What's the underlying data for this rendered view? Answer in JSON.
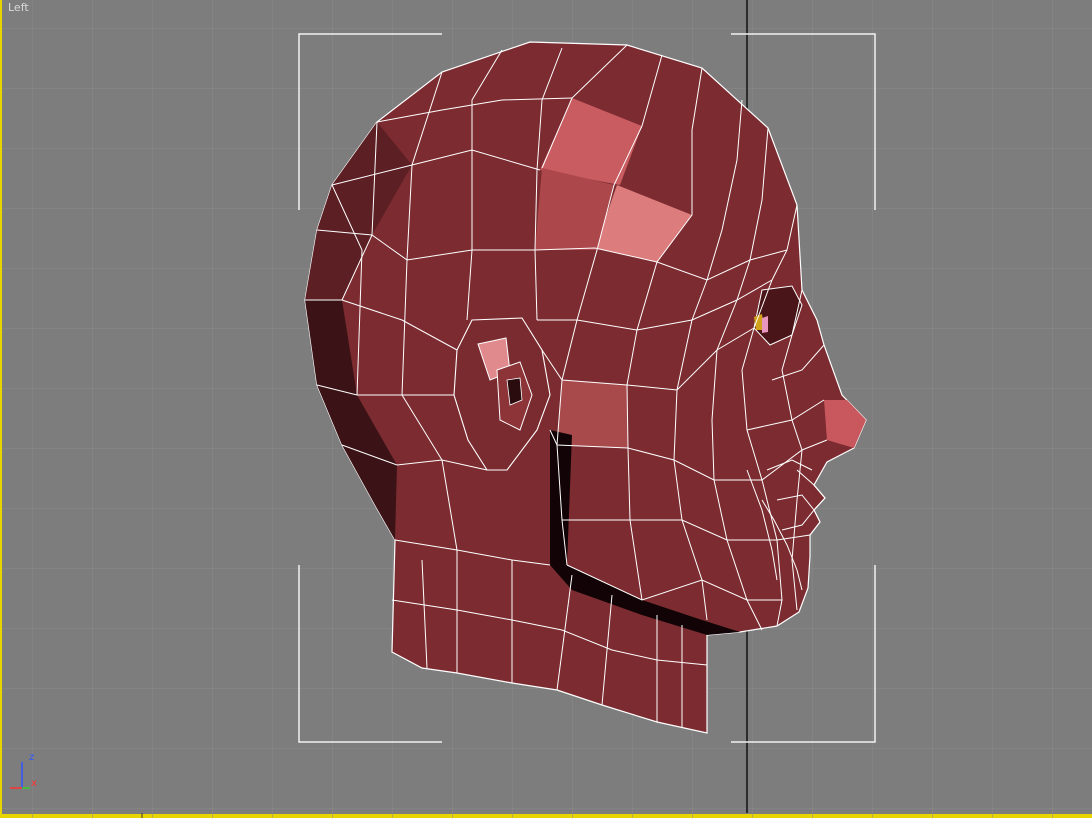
{
  "viewport": {
    "label": "Left",
    "active_border_color": "#e8d400",
    "background_color": "#7d7d7d",
    "grid_color": "#8a8a8a"
  },
  "model": {
    "color": "#8b3338",
    "wire_color": "#ffffff",
    "highlight_color": "#e07a7a"
  },
  "axis_gizmo": {
    "z_label": "z",
    "x_label": "x"
  }
}
